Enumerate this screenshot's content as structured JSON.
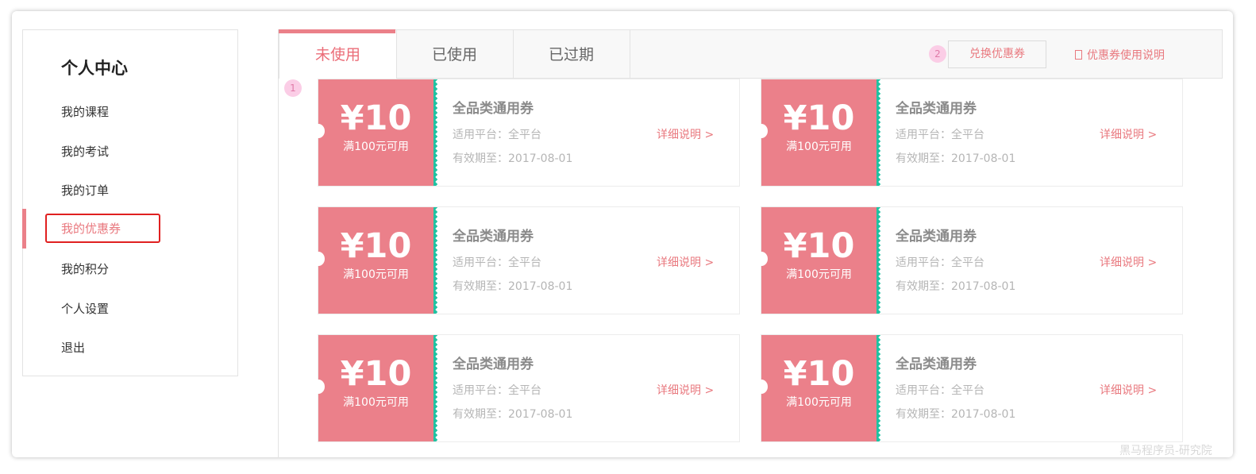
{
  "sidebar": {
    "title": "个人中心",
    "items": [
      {
        "label": "我的课程"
      },
      {
        "label": "我的考试"
      },
      {
        "label": "我的订单"
      },
      {
        "label": "我的优惠券",
        "active": true
      },
      {
        "label": "我的积分"
      },
      {
        "label": "个人设置"
      },
      {
        "label": "退出"
      }
    ]
  },
  "tabs": [
    {
      "label": "未使用",
      "active": true
    },
    {
      "label": "已使用"
    },
    {
      "label": "已过期"
    }
  ],
  "toolbar": {
    "redeem_label": "兑换优惠券",
    "help_label": "优惠券使用说明"
  },
  "annotations": {
    "badge_1": "1",
    "badge_2": "2"
  },
  "coupons": [
    {
      "amount": "¥10",
      "condition": "满100元可用",
      "name": "全品类通用券",
      "platform": "适用平台：全平台",
      "expiry": "有效期至：2017-08-01",
      "detail": "详细说明 >"
    },
    {
      "amount": "¥10",
      "condition": "满100元可用",
      "name": "全品类通用券",
      "platform": "适用平台：全平台",
      "expiry": "有效期至：2017-08-01",
      "detail": "详细说明 >"
    },
    {
      "amount": "¥10",
      "condition": "满100元可用",
      "name": "全品类通用券",
      "platform": "适用平台：全平台",
      "expiry": "有效期至：2017-08-01",
      "detail": "详细说明 >"
    },
    {
      "amount": "¥10",
      "condition": "满100元可用",
      "name": "全品类通用券",
      "platform": "适用平台：全平台",
      "expiry": "有效期至：2017-08-01",
      "detail": "详细说明 >"
    },
    {
      "amount": "¥10",
      "condition": "满100元可用",
      "name": "全品类通用券",
      "platform": "适用平台：全平台",
      "expiry": "有效期至：2017-08-01",
      "detail": "详细说明 >"
    },
    {
      "amount": "¥10",
      "condition": "满100元可用",
      "name": "全品类通用券",
      "platform": "适用平台：全平台",
      "expiry": "有效期至：2017-08-01",
      "detail": "详细说明 >"
    }
  ],
  "watermark": "黑马程序员-研究院",
  "colors": {
    "accent": "#eb808a",
    "accent_text": "#e9797f",
    "perforation": "#1fc2a2",
    "highlight_outline": "#e02020"
  }
}
